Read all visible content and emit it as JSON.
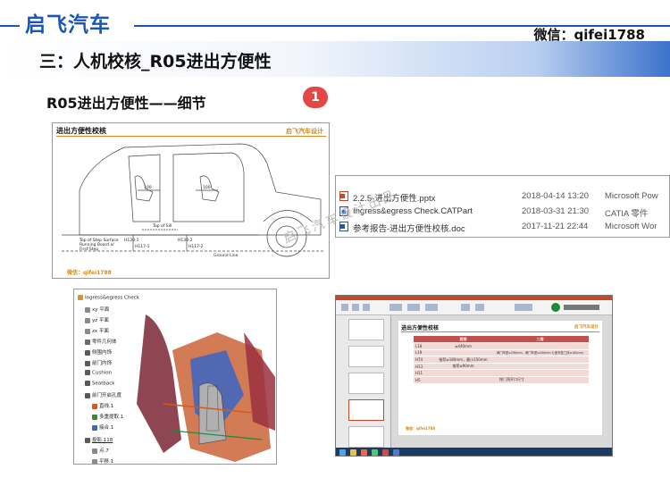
{
  "header": {
    "brand": "启飞汽车",
    "wechat": "微信：qifei1788",
    "accent_color": "#1a56b4"
  },
  "section": {
    "title": "三：人机校核_R05进出方便性"
  },
  "content": {
    "subtitle": "R05进出方便性——细节",
    "badge": "1"
  },
  "drawing_panel": {
    "title": "进出方便性校核",
    "brand": "启飞汽车设计",
    "wechat": "微信：qifei1788",
    "labels": {
      "dim1": "100",
      "dim2": "100",
      "dim3": "H130-1",
      "dim4": "H130-2",
      "dim5": "H117-1",
      "dim6": "H117-2",
      "top_of_sill": "Top of Sill",
      "step_surface_1": "Top of Step Surface",
      "step_surface_2": "Running Board or",
      "step_surface_3": "First Step",
      "ground": "Ground Line"
    }
  },
  "file_list": [
    {
      "icon": "pptx-icon",
      "name": "2.2.5-进出方便性.pptx",
      "date": "2018-04-14 13:20",
      "type": "Microsoft Pow"
    },
    {
      "icon": "catpart-icon",
      "name": "Ingress&egress Check.CATPart",
      "date": "2018-03-31 21:30",
      "type": "CATIA 零件"
    },
    {
      "icon": "doc-icon",
      "name": "参考报告-进出方便性校核.doc",
      "date": "2017-11-21 22:44",
      "type": "Microsoft Wor"
    }
  ],
  "watermark": "启飞汽车设计出品",
  "catia_tree": {
    "root": "Ingress&egress Check",
    "items": [
      "xy 平面",
      "yz 平面",
      "zx 平面",
      "零件几何体",
      "侧围内饰",
      "前门内饰",
      "Cushion",
      "Seatback",
      "前门开启孔度",
      "直线.1",
      "多重提取.1",
      "接合.1",
      "投影.118",
      "点.7",
      "平移.1"
    ]
  },
  "ppt_panel": {
    "slide_title": "进出方便性校核",
    "slide_brand": "启飞汽车设计",
    "slide_wechat": "微信：qifei1788",
    "table": {
      "headers": [
        "",
        "前排",
        "二排"
      ],
      "rows": [
        [
          "L18",
          "≥440mm",
          ""
        ],
        [
          "L19",
          "",
          "两门车型≥290mm，两门车型≥200mm 七座车型三排≥180mm"
        ],
        [
          "H74",
          "推荐≥180mm，最小150mm",
          ""
        ],
        [
          "H13",
          "推荐≥90mm",
          ""
        ],
        [
          "H11",
          "",
          ""
        ],
        [
          "H5",
          "按门洞开口尺寸",
          ""
        ]
      ]
    }
  }
}
